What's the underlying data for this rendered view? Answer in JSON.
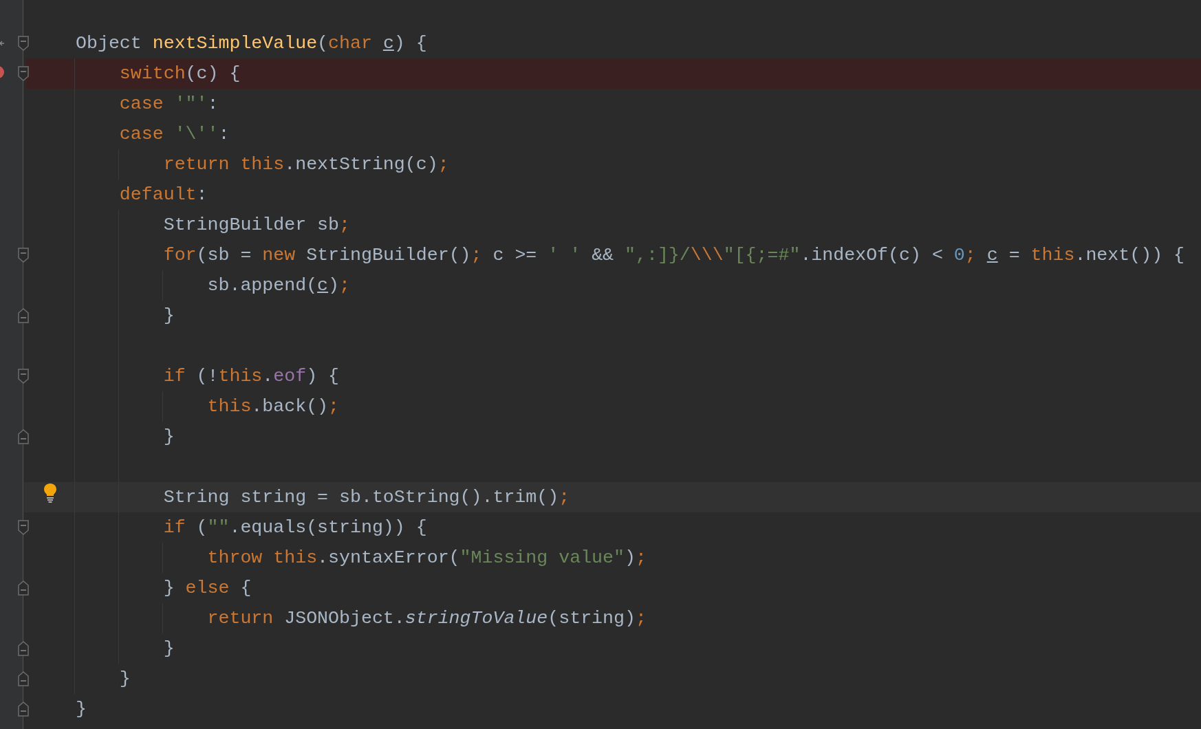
{
  "editor": {
    "lines": [
      {
        "kind": "code",
        "fold_start": true,
        "override_marker": true,
        "tokens": [
          {
            "kind": "plain",
            "text": "Object "
          },
          {
            "kind": "declaration",
            "text": "nextSimpleValue"
          },
          {
            "kind": "plain",
            "text": "("
          },
          {
            "kind": "keyword",
            "text": "char "
          },
          {
            "kind": "param",
            "text": "c"
          },
          {
            "kind": "plain",
            "text": ") {"
          }
        ]
      },
      {
        "kind": "code",
        "fold_start": true,
        "breakpoint": true,
        "tokens": [
          {
            "kind": "keyword",
            "text": "    switch"
          },
          {
            "kind": "plain",
            "text": "(c) {"
          }
        ]
      },
      {
        "kind": "code",
        "tokens": [
          {
            "kind": "keyword",
            "text": "    case "
          },
          {
            "kind": "string",
            "text": "'\"'"
          },
          {
            "kind": "plain",
            "text": ":"
          }
        ]
      },
      {
        "kind": "code",
        "tokens": [
          {
            "kind": "keyword",
            "text": "    case "
          },
          {
            "kind": "string",
            "text": "'\\''"
          },
          {
            "kind": "plain",
            "text": ":"
          }
        ]
      },
      {
        "kind": "code",
        "tokens": [
          {
            "kind": "keyword",
            "text": "        return this"
          },
          {
            "kind": "plain",
            "text": ".nextString(c)"
          },
          {
            "kind": "keyword",
            "text": ";"
          }
        ]
      },
      {
        "kind": "code",
        "tokens": [
          {
            "kind": "keyword",
            "text": "    default"
          },
          {
            "kind": "plain",
            "text": ":"
          }
        ]
      },
      {
        "kind": "code",
        "tokens": [
          {
            "kind": "plain",
            "text": "        StringBuilder sb"
          },
          {
            "kind": "keyword",
            "text": ";"
          }
        ]
      },
      {
        "kind": "code",
        "fold_start": true,
        "tokens": [
          {
            "kind": "keyword",
            "text": "        for"
          },
          {
            "kind": "plain",
            "text": "(sb = "
          },
          {
            "kind": "keyword",
            "text": "new"
          },
          {
            "kind": "plain",
            "text": " StringBuilder()"
          },
          {
            "kind": "keyword",
            "text": ";"
          },
          {
            "kind": "plain",
            "text": " c >= "
          },
          {
            "kind": "string",
            "text": "' '"
          },
          {
            "kind": "plain",
            "text": " && "
          },
          {
            "kind": "string",
            "text": "\",:]}/"
          },
          {
            "kind": "escape",
            "text": "\\\\\\"
          },
          {
            "kind": "string",
            "text": "\"[{;=#\""
          },
          {
            "kind": "plain",
            "text": ".indexOf(c) < "
          },
          {
            "kind": "number",
            "text": "0"
          },
          {
            "kind": "keyword",
            "text": "; "
          },
          {
            "kind": "param",
            "text": "c"
          },
          {
            "kind": "plain",
            "text": " = "
          },
          {
            "kind": "keyword",
            "text": "this"
          },
          {
            "kind": "plain",
            "text": ".next()) {"
          }
        ]
      },
      {
        "kind": "code",
        "tokens": [
          {
            "kind": "plain",
            "text": "            sb.append("
          },
          {
            "kind": "param",
            "text": "c"
          },
          {
            "kind": "plain",
            "text": ")"
          },
          {
            "kind": "keyword",
            "text": ";"
          }
        ]
      },
      {
        "kind": "code",
        "fold_end": true,
        "tokens": [
          {
            "kind": "plain",
            "text": "        }"
          }
        ]
      },
      {
        "kind": "blank"
      },
      {
        "kind": "code",
        "fold_start": true,
        "tokens": [
          {
            "kind": "keyword",
            "text": "        if"
          },
          {
            "kind": "plain",
            "text": " (!"
          },
          {
            "kind": "keyword",
            "text": "this"
          },
          {
            "kind": "plain",
            "text": "."
          },
          {
            "kind": "field",
            "text": "eof"
          },
          {
            "kind": "plain",
            "text": ") {"
          }
        ]
      },
      {
        "kind": "code",
        "tokens": [
          {
            "kind": "keyword",
            "text": "            this"
          },
          {
            "kind": "plain",
            "text": ".back()"
          },
          {
            "kind": "keyword",
            "text": ";"
          }
        ]
      },
      {
        "kind": "code",
        "fold_end": true,
        "tokens": [
          {
            "kind": "plain",
            "text": "        }"
          }
        ]
      },
      {
        "kind": "blank"
      },
      {
        "kind": "code",
        "caret_line": true,
        "intention_bulb": true,
        "tokens": [
          {
            "kind": "plain",
            "text": "        String string = sb.toString().trim()"
          },
          {
            "kind": "keyword",
            "text": ";"
          }
        ]
      },
      {
        "kind": "code",
        "fold_start": true,
        "tokens": [
          {
            "kind": "keyword",
            "text": "        if"
          },
          {
            "kind": "plain",
            "text": " ("
          },
          {
            "kind": "string",
            "text": "\"\""
          },
          {
            "kind": "plain",
            "text": ".equals(string)) {"
          }
        ]
      },
      {
        "kind": "code",
        "tokens": [
          {
            "kind": "keyword",
            "text": "            throw this"
          },
          {
            "kind": "plain",
            "text": ".syntaxError("
          },
          {
            "kind": "string",
            "text": "\"Missing value\""
          },
          {
            "kind": "plain",
            "text": ")"
          },
          {
            "kind": "keyword",
            "text": ";"
          }
        ]
      },
      {
        "kind": "code",
        "fold_end": true,
        "tokens": [
          {
            "kind": "plain",
            "text": "        } "
          },
          {
            "kind": "keyword",
            "text": "else"
          },
          {
            "kind": "plain",
            "text": " {"
          }
        ]
      },
      {
        "kind": "code",
        "tokens": [
          {
            "kind": "keyword",
            "text": "            return"
          },
          {
            "kind": "plain",
            "text": " JSONObject."
          },
          {
            "kind": "static",
            "text": "stringToValue"
          },
          {
            "kind": "plain",
            "text": "(string)"
          },
          {
            "kind": "keyword",
            "text": ";"
          }
        ]
      },
      {
        "kind": "code",
        "fold_end": true,
        "tokens": [
          {
            "kind": "plain",
            "text": "        }"
          }
        ]
      },
      {
        "kind": "code",
        "fold_end": true,
        "tokens": [
          {
            "kind": "plain",
            "text": "    }"
          }
        ]
      },
      {
        "kind": "code",
        "fold_end": true,
        "tokens": [
          {
            "kind": "plain",
            "text": "}"
          }
        ]
      }
    ]
  }
}
